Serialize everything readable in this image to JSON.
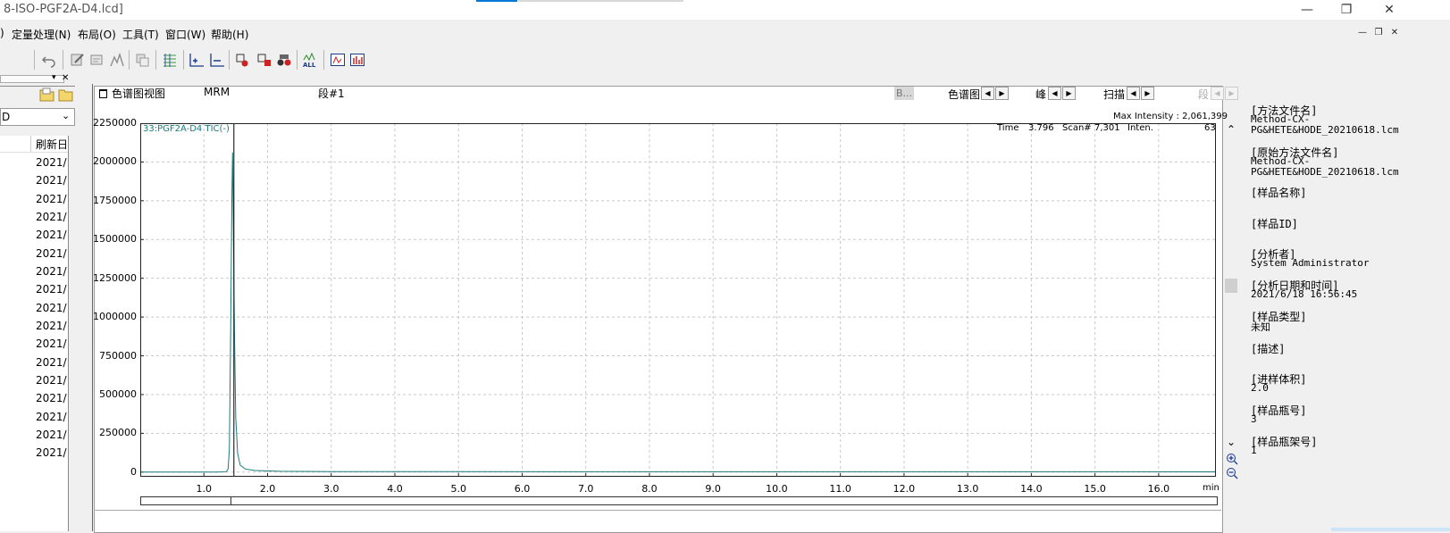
{
  "window": {
    "title": "8-ISO-PGF2A-D4.lcd]"
  },
  "menu": [
    {
      "label": ")"
    },
    {
      "label": "定量处理(N)"
    },
    {
      "label": "布局(O)"
    },
    {
      "label": "工具(T)"
    },
    {
      "label": "窗口(W)"
    },
    {
      "label": "帮助(H)"
    }
  ],
  "left_panel": {
    "dropdown_value": "D",
    "column_header": "刷新日",
    "rows": [
      "2021/",
      "2021/",
      "2021/",
      "2021/",
      "2021/",
      "2021/",
      "2021/",
      "2021/",
      "2021/",
      "2021/",
      "2021/",
      "2021/",
      "2021/",
      "2021/",
      "2021/",
      "2021/",
      "2021/"
    ]
  },
  "chrom_header": {
    "view_title": "色谱图视图",
    "mode": "MRM",
    "segment": "段#1",
    "b_button": "B...",
    "chrom_label": "色谱图",
    "peak_label": "峰",
    "scan_label": "扫描",
    "seg_label": "段"
  },
  "plot_info": {
    "trace_label": "33:PGF2A-D4 TIC(-)",
    "max_intensity": "Max Intensity : 2,061,399",
    "time_label": "Time",
    "time_value": "3.796",
    "scan_label": "Scan#",
    "scan_value": "7,301",
    "inten_label": "Inten.",
    "inten_value": "63",
    "x_unit": "min"
  },
  "chart_data": {
    "type": "line",
    "xlim": [
      0.0,
      16.9
    ],
    "ylim": [
      -30000,
      2250000
    ],
    "x_ticks": [
      "1.0",
      "2.0",
      "3.0",
      "4.0",
      "5.0",
      "6.0",
      "7.0",
      "8.0",
      "9.0",
      "10.0",
      "11.0",
      "12.0",
      "13.0",
      "14.0",
      "15.0",
      "16.0"
    ],
    "y_ticks": [
      "0",
      "250000",
      "500000",
      "750000",
      "1000000",
      "1250000",
      "1500000",
      "1750000",
      "2000000",
      "2250000"
    ],
    "series": [
      {
        "color": "#1a7a7a",
        "x": [
          0.0,
          1.2,
          1.35,
          1.38,
          1.4,
          1.42,
          1.44,
          1.45,
          1.46,
          1.48,
          1.5,
          1.53,
          1.57,
          1.65,
          1.8,
          2.2,
          3.0,
          16.9
        ],
        "y": [
          0,
          0,
          2000,
          20000,
          150000,
          900000,
          1800000,
          2061399,
          1700000,
          900000,
          350000,
          120000,
          45000,
          20000,
          10000,
          5000,
          3000,
          2000
        ]
      }
    ],
    "cursor_x": 1.45,
    "grid": true
  },
  "info_panel": [
    {
      "label": "[方法文件名]",
      "lines": [
        "Method-CX-",
        "PG&HETE&HODE_20210618.lcm"
      ]
    },
    {
      "label": "[原始方法文件名]",
      "lines": [
        "Method-CX-",
        "PG&HETE&HODE_20210618.lcm"
      ]
    },
    {
      "label": "[样品名称]",
      "lines": []
    },
    {
      "label": "[样品ID]",
      "lines": []
    },
    {
      "label": "[分析者]",
      "lines": [
        "System Administrator"
      ]
    },
    {
      "label": "[分析日期和时间]",
      "lines": [
        "2021/6/18 16:56:45"
      ]
    },
    {
      "label": "[样品类型]",
      "lines": [
        "未知"
      ]
    },
    {
      "label": "[描述]",
      "lines": []
    },
    {
      "label": "[进样体积]",
      "lines": [
        "2.0"
      ]
    },
    {
      "label": "[样品瓶号]",
      "lines": [
        "3"
      ]
    },
    {
      "label": "[样品瓶架号]",
      "lines": [
        "1"
      ]
    }
  ],
  "colors": {
    "trace": "#1a7a7a",
    "grid": "#c8c8c8",
    "accent": "#0078d7"
  }
}
